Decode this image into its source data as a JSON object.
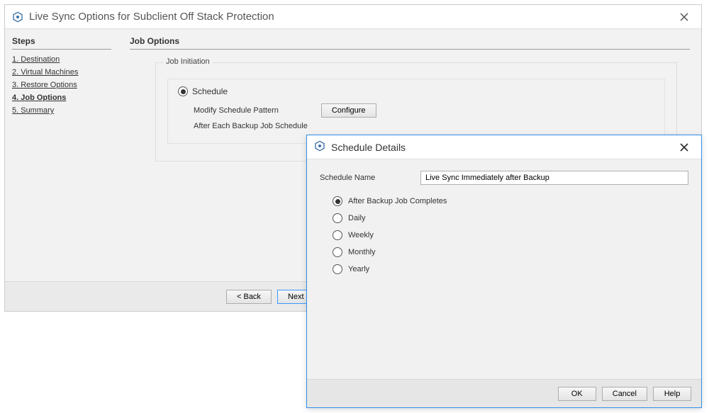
{
  "wizard": {
    "title": "Live Sync Options for Subclient Off Stack Protection",
    "steps_header": "Steps",
    "steps": [
      {
        "label": "1. Destination",
        "current": false
      },
      {
        "label": "2. Virtual Machines",
        "current": false
      },
      {
        "label": "3. Restore Options",
        "current": false
      },
      {
        "label": "4. Job Options",
        "current": true
      },
      {
        "label": "5. Summary",
        "current": false
      }
    ],
    "section_header": "Job Options",
    "job_initiation_legend": "Job Initiation",
    "schedule_radio_label": "Schedule",
    "modify_pattern_label": "Modify Schedule Pattern",
    "configure_button": "Configure",
    "after_each_label": "After Each Backup Job Schedule",
    "back_button": "< Back",
    "next_button": "Next >"
  },
  "modal": {
    "title": "Schedule Details",
    "schedule_name_label": "Schedule Name",
    "schedule_name_value": "Live Sync Immediately after Backup",
    "options": [
      {
        "label": "After Backup Job Completes",
        "selected": true
      },
      {
        "label": "Daily",
        "selected": false
      },
      {
        "label": "Weekly",
        "selected": false
      },
      {
        "label": "Monthly",
        "selected": false
      },
      {
        "label": "Yearly",
        "selected": false
      }
    ],
    "ok_button": "OK",
    "cancel_button": "Cancel",
    "help_button": "Help"
  }
}
